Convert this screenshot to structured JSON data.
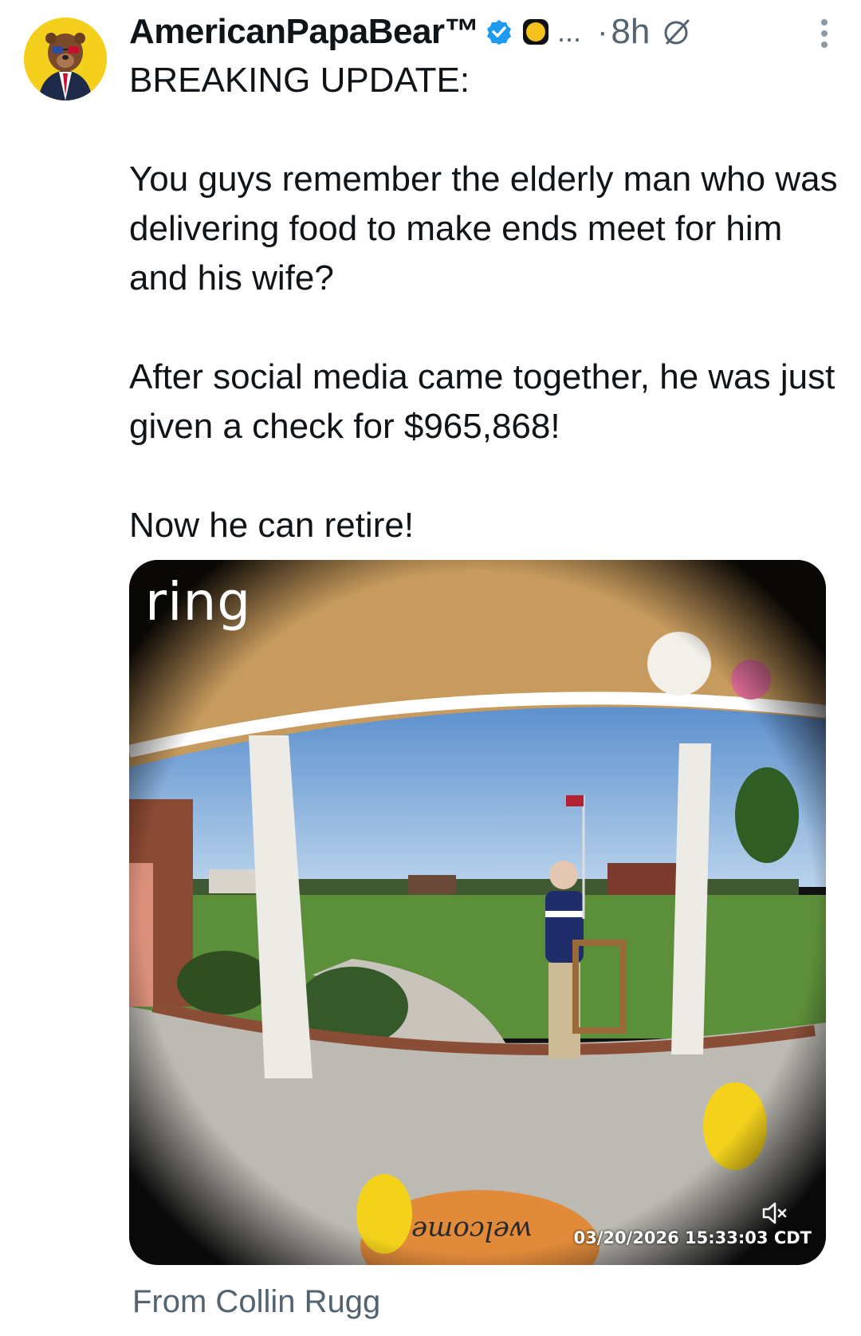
{
  "header": {
    "display_name": "AmericanPapaBear™",
    "ellipsis": "...",
    "separator": "·",
    "time": "8h",
    "icons": [
      "avatar-bear",
      "verified-badge-icon",
      "emoji-badge-icon",
      "grok-icon",
      "more-vertical-icon"
    ]
  },
  "tweet": {
    "paragraphs": [
      "BREAKING UPDATE:",
      "You guys remember the elderly man who was delivering food to make ends meet for him and his wife?",
      "After social media came together, he was just given a check for $965,868!",
      "Now he can retire!"
    ]
  },
  "media": {
    "brand_logo": "ring",
    "timestamp": "03/20/2026 15:33:03 CDT",
    "mat_text": "welcome",
    "muted": true
  },
  "footer": {
    "source": "From Collin Rugg"
  },
  "colors": {
    "text": "#0f1419",
    "secondary": "#536471",
    "verified": "#1d9bf0",
    "avatar_bg": "#f4cf1c"
  }
}
